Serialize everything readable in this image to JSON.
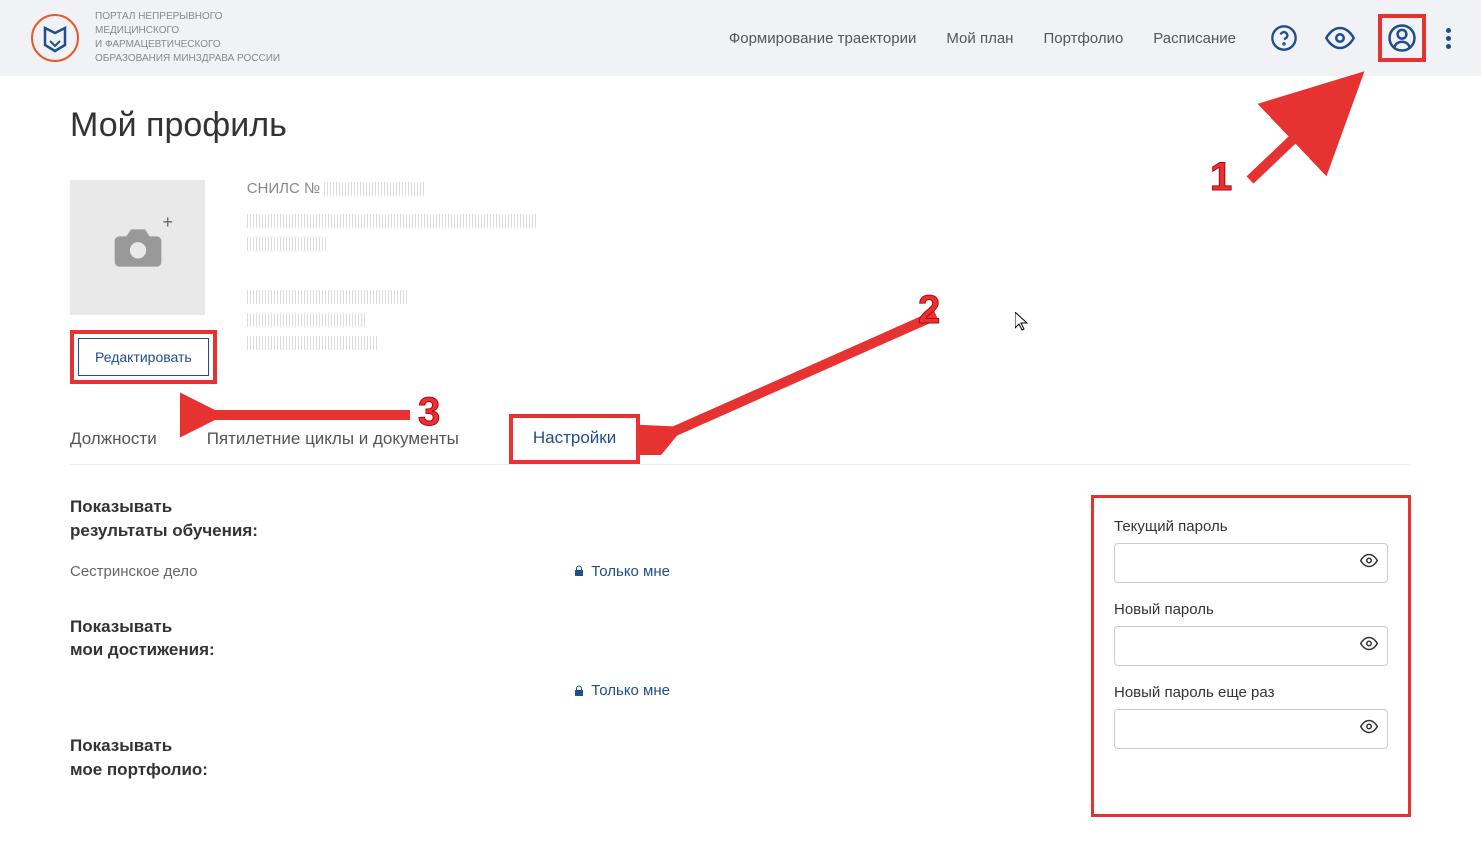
{
  "header": {
    "logo_text": "ПОРТАЛ НЕПРЕРЫВНОГО\nМЕДИЦИНСКОГО\nИ ФАРМАЦЕВТИЧЕСКОГО\nОБРАЗОВАНИЯ МИНЗДРАВА РОССИИ",
    "nav": {
      "trajectory": "Формирование траектории",
      "plan": "Мой план",
      "portfolio": "Портфолио",
      "schedule": "Расписание"
    }
  },
  "page": {
    "title": "Мой профиль",
    "snils_label": "СНИЛС №",
    "edit_button": "Редактировать"
  },
  "tabs": {
    "positions": "Должности",
    "cycles": "Пятилетние циклы и документы",
    "settings": "Настройки"
  },
  "settings": {
    "show_results_label": "Показывать\nрезультаты обучения:",
    "nursing": "Сестринское дело",
    "only_me": "Только мне",
    "show_achievements_label": "Показывать\nмои достижения:",
    "show_portfolio_label": "Показывать\nмое портфолио:"
  },
  "password": {
    "current_label": "Текущий пароль",
    "new_label": "Новый пароль",
    "repeat_label": "Новый пароль еще раз"
  },
  "annotations": {
    "n1": "1",
    "n2": "2",
    "n3": "3"
  }
}
